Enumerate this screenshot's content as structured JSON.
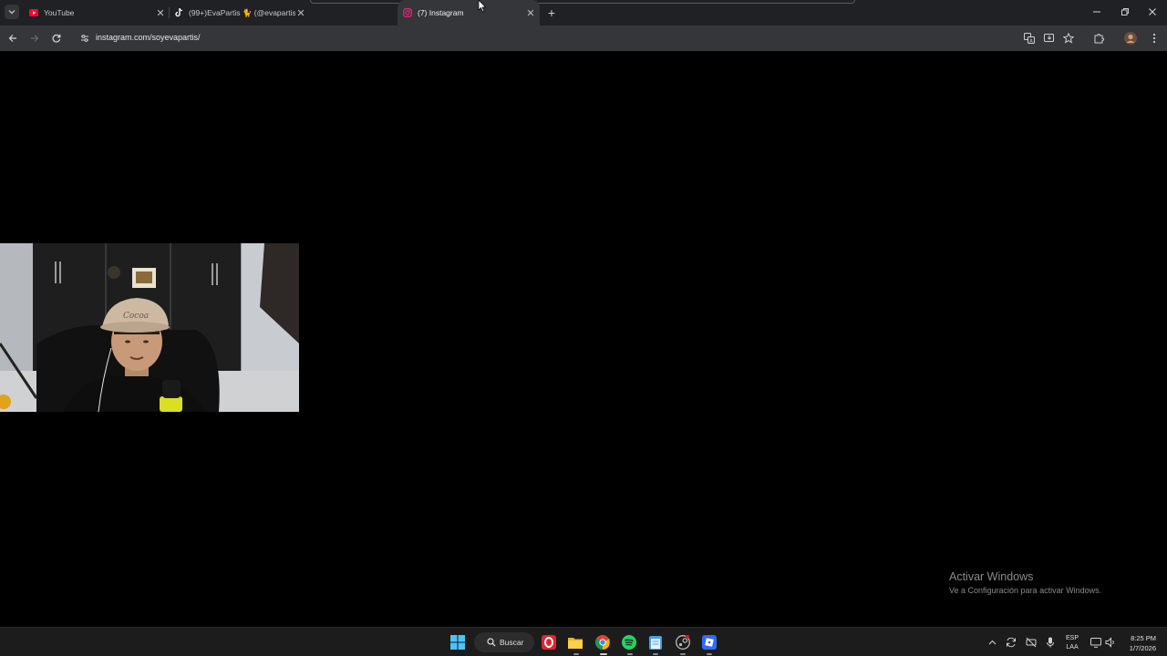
{
  "browser": {
    "tabs": [
      {
        "label": "YouTube",
        "icon": "youtube-icon",
        "active": false
      },
      {
        "label": "(99+)EvaPartis 🐈 (@evapartis)",
        "icon": "tiktok-icon",
        "active": false
      },
      {
        "label": "(7) Instagram",
        "icon": "instagram-icon",
        "active": true
      }
    ],
    "url": "instagram.com/soyevapartis/"
  },
  "watermark": {
    "title": "Activar Windows",
    "subtitle": "Ve a Configuración para activar Windows."
  },
  "taskbar": {
    "search_label": "Buscar",
    "apps": [
      "windows-start-icon",
      "opera-icon",
      "file-explorer-icon",
      "chrome-icon",
      "spotify-icon",
      "notepad-icon",
      "steam-icon",
      "roblox-studio-icon"
    ],
    "language": {
      "line1": "ESP",
      "line2": "LAA"
    },
    "time": "8:25 PM",
    "date": "1/7/2026"
  },
  "colors": {
    "tabstrip": "#202124",
    "toolbar": "#35363a",
    "content": "#000000",
    "youtube_red": "#ff0033",
    "instagram_pink": "#d62976"
  }
}
